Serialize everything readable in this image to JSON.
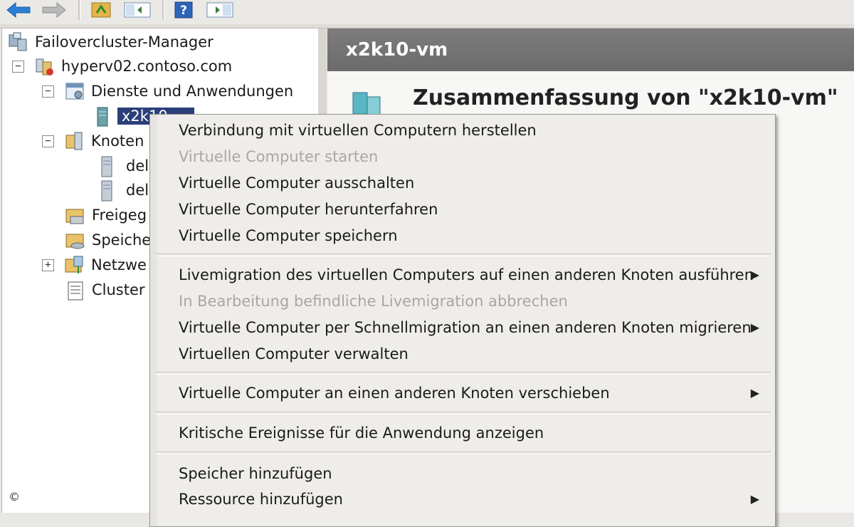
{
  "toolbar": {
    "buttons": [
      {
        "icon": "back-arrow-icon"
      },
      {
        "icon": "forward-arrow-icon"
      },
      {
        "icon": "up-folder-icon"
      },
      {
        "icon": "show-hide-console-tree-icon"
      },
      {
        "icon": "help-icon"
      },
      {
        "icon": "show-hide-action-pane-icon"
      }
    ]
  },
  "tree": {
    "root": "Failovercluster-Manager",
    "cluster": "hyperv02.contoso.com",
    "services": "Dienste und Anwendungen",
    "vm_partial": "x2k10",
    "nodes": "Knoten",
    "node1_partial": "dell",
    "node2_partial": "dell",
    "shared_partial": "Freigeg",
    "storage_partial": "Speiche",
    "networks_partial": "Netzwe",
    "events_partial": "Cluster"
  },
  "right": {
    "header": "x2k10-vm",
    "summary_title": "Zusammenfassung von \"x2k10-vm\""
  },
  "context_menu": {
    "items": [
      {
        "label": "Verbindung mit virtuellen Computern herstellen",
        "enabled": true,
        "submenu": false
      },
      {
        "label": "Virtuelle Computer starten",
        "enabled": false,
        "submenu": false
      },
      {
        "label": "Virtuelle Computer ausschalten",
        "enabled": true,
        "submenu": false
      },
      {
        "label": "Virtuelle Computer herunterfahren",
        "enabled": true,
        "submenu": false
      },
      {
        "label": "Virtuelle Computer speichern",
        "enabled": true,
        "submenu": false
      },
      {
        "label": "Livemigration des virtuellen Computers auf einen anderen Knoten ausführen",
        "enabled": true,
        "submenu": true
      },
      {
        "label": "In Bearbeitung befindliche Livemigration abbrechen",
        "enabled": false,
        "submenu": false
      },
      {
        "label": "Virtuelle Computer per Schnellmigration an einen anderen Knoten migrieren",
        "enabled": true,
        "submenu": true
      },
      {
        "label": "Virtuellen Computer verwalten",
        "enabled": true,
        "submenu": false
      },
      {
        "label": "Virtuelle Computer an einen anderen Knoten verschieben",
        "enabled": true,
        "submenu": true
      },
      {
        "label": "Kritische Ereignisse für die Anwendung anzeigen",
        "enabled": true,
        "submenu": false
      },
      {
        "label": "Speicher hinzufügen",
        "enabled": true,
        "submenu": false
      },
      {
        "label": "Ressource hinzufügen",
        "enabled": true,
        "submenu": true
      }
    ],
    "submenu_glyph": "▶"
  },
  "copyright": "©",
  "colors": {
    "selection": "#2b3f7a",
    "header": "#737373",
    "disabled_text": "#a9a7a3"
  }
}
